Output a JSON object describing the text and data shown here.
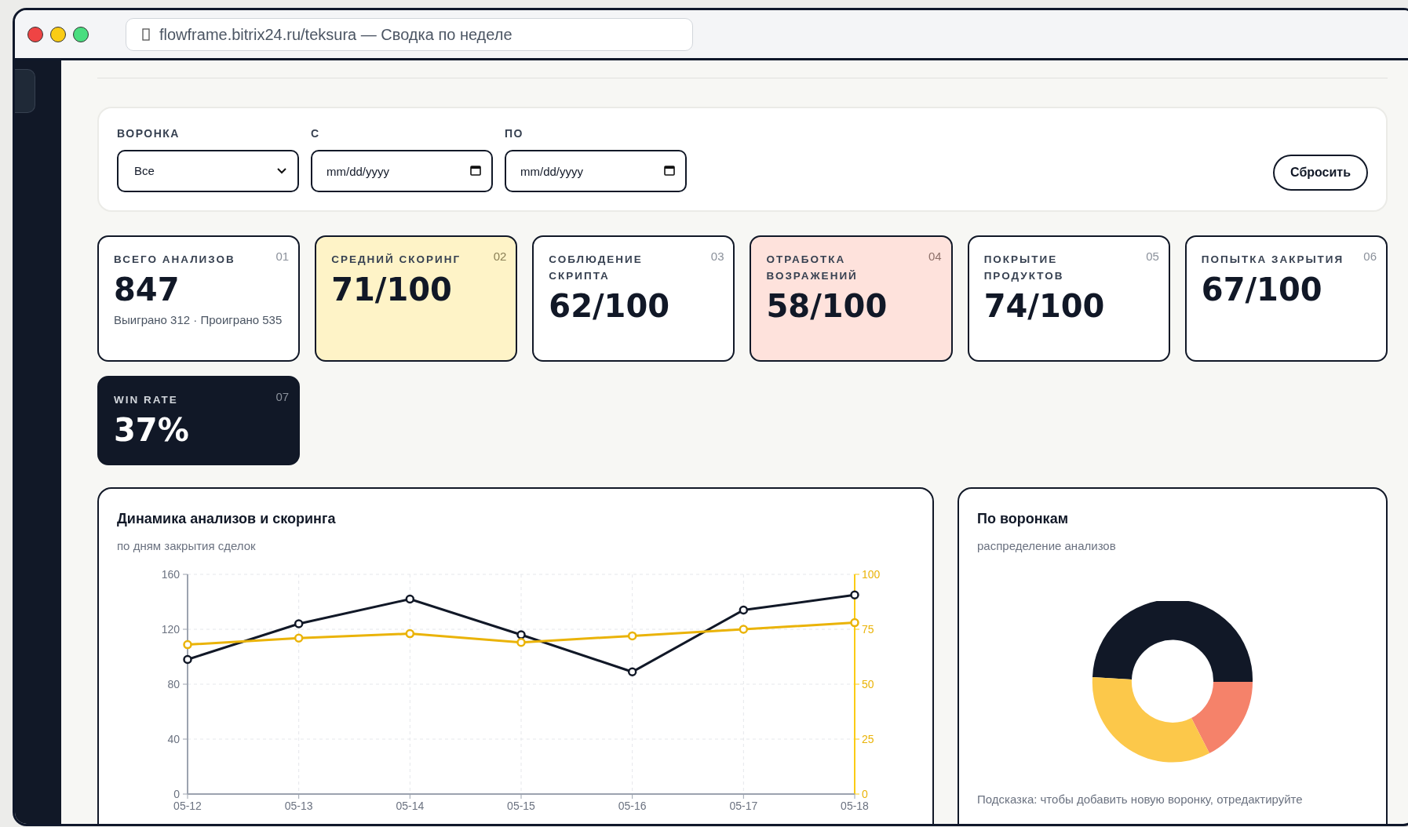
{
  "browser": {
    "address": "flowframe.bitrix24.ru/teksura — Сводка по неделе"
  },
  "filters": [
    {
      "kind": "select",
      "label": "ВОРОНКА",
      "value": "Все"
    },
    {
      "kind": "date",
      "label": "С",
      "placeholder": "mm/dd/yyyy"
    },
    {
      "kind": "date",
      "label": "ПО",
      "placeholder": "mm/dd/yyyy"
    }
  ],
  "reset_button": "Сбросить",
  "kpis": [
    {
      "kind": "neutral",
      "label": "ВСЕГО АНАЛИЗОВ",
      "index": "01",
      "value": "847",
      "note": "Выиграно 312 · Проиграно 535"
    },
    {
      "kind": "highlight",
      "label": "СРЕДНИЙ СКОРИНГ",
      "index": "02",
      "value": "71/100"
    },
    {
      "kind": "neutral",
      "label": "СОБЛЮДЕНИЕ СКРИПТА",
      "index": "03",
      "value": "62/100"
    },
    {
      "kind": "alert",
      "label": "ОТРАБОТКА ВОЗРАЖЕНИЙ",
      "index": "04",
      "value": "58/100"
    },
    {
      "kind": "neutral",
      "label": "ПОКРЫТИЕ ПРОДУКТОВ",
      "index": "05",
      "value": "74/100"
    },
    {
      "kind": "neutral",
      "label": "ПОПЫТКА ЗАКРЫТИЯ",
      "index": "06",
      "value": "67/100"
    },
    {
      "kind": "dark",
      "label": "WIN RATE",
      "index": "07",
      "value": "37%"
    }
  ],
  "trend_card": {
    "title": "Динамика анализов и скоринга",
    "subtitle": "по дням закрытия сделок",
    "chart_data": {
      "type": "line",
      "categories": [
        "05-12",
        "05-13",
        "05-14",
        "05-15",
        "05-16",
        "05-17",
        "05-18"
      ],
      "series": [
        {
          "color": "#111827",
          "marker": "circle",
          "values": [
            98,
            124,
            142,
            116,
            89,
            134,
            145
          ]
        },
        {
          "color": "#eab308",
          "marker": "circle",
          "axis": "y2",
          "values": [
            68,
            71,
            73,
            69,
            72,
            75,
            78
          ]
        }
      ],
      "grid": true,
      "ylim": [
        0,
        160
      ],
      "yticks": [
        0,
        40,
        80,
        120,
        160
      ],
      "y2lim": [
        0,
        100
      ],
      "y2ticks": [
        0,
        25,
        50,
        75,
        100
      ]
    }
  },
  "funnel_card": {
    "title": "По воронкам",
    "subtitle": "распределение анализов",
    "hint": "Подсказка: чтобы добавить новую воронку, отредактируйте"
  }
}
